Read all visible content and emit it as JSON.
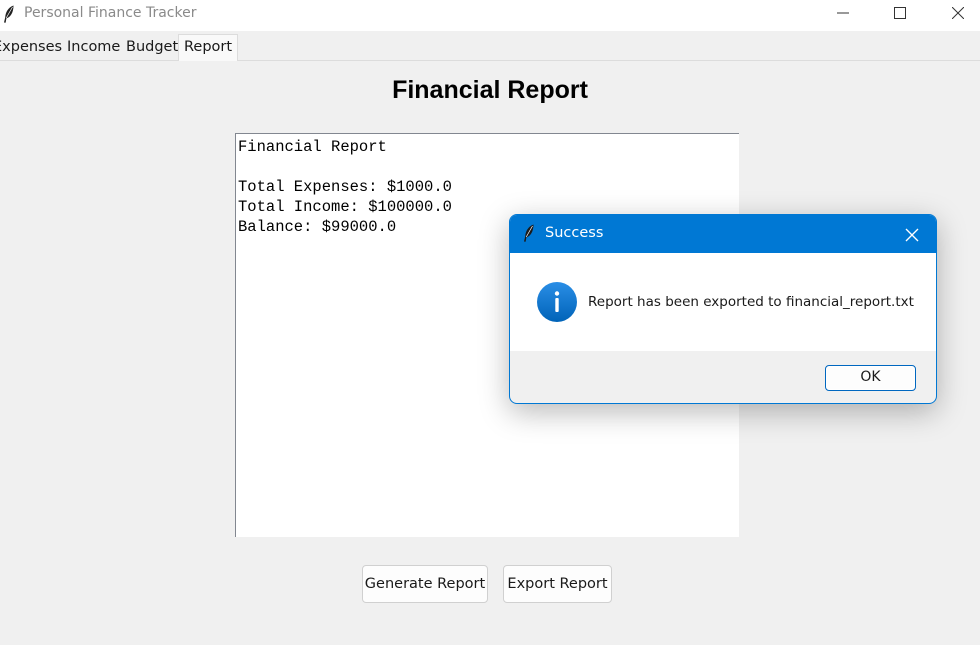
{
  "window": {
    "title": "Personal Finance Tracker",
    "icon": "feather-icon",
    "controls": [
      "minimize-icon",
      "maximize-icon",
      "close-icon"
    ]
  },
  "tabs": [
    {
      "label": "Expenses",
      "selected": false
    },
    {
      "label": "Income",
      "selected": false
    },
    {
      "label": "Budget",
      "selected": false
    },
    {
      "label": "Report",
      "selected": true
    }
  ],
  "main": {
    "title": "Financial Report",
    "report_text": "Financial Report\n\nTotal Expenses: $1000.0\nTotal Income: $100000.0\nBalance: $99000.0",
    "buttons": {
      "generate": "Generate Report",
      "export": "Export Report"
    }
  },
  "dialog": {
    "title": "Success",
    "icon": "info-icon",
    "message": "Report has been exported to financial_report.txt",
    "ok_label": "OK"
  },
  "colors": {
    "accent": "#0078d4",
    "background": "#f0f0f0"
  }
}
